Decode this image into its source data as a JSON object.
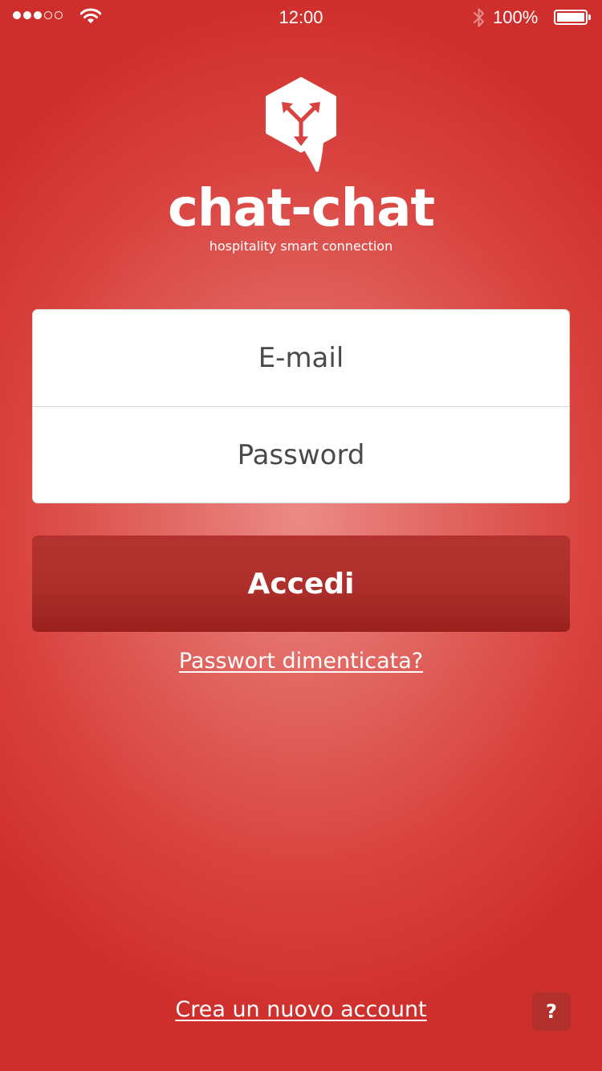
{
  "status_bar": {
    "time": "12:00",
    "battery_percent": "100%",
    "signal_bars_filled": 3,
    "signal_bars_total": 5,
    "battery_level": 1.0
  },
  "brand": {
    "name": "chat-chat",
    "tagline": "hospitality smart connection"
  },
  "login": {
    "email_placeholder": "E-mail",
    "password_placeholder": "Password",
    "submit_label": "Accedi",
    "forgot_label": "Passwort dimenticata?"
  },
  "footer": {
    "create_account_label": "Crea un nuovo account",
    "help_label": "?"
  },
  "colors": {
    "background": "#d9423e",
    "button": "#ad2f2b",
    "text": "#ffffff"
  },
  "icons": {
    "logo": "chat-bubble-arrows-icon",
    "wifi": "wifi-icon",
    "bluetooth": "bluetooth-icon",
    "battery": "battery-icon"
  }
}
